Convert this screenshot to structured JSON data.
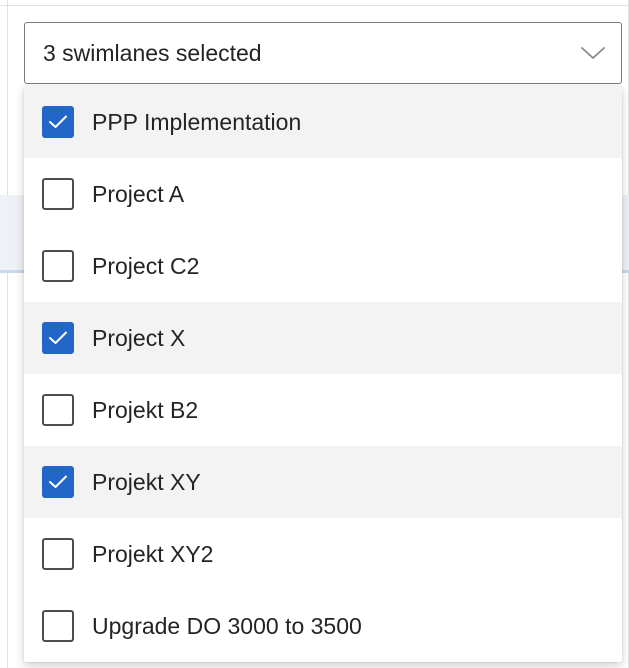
{
  "select": {
    "value": "3 swimlanes selected",
    "chevron_icon": "chevron-down-icon"
  },
  "colors": {
    "accent": "#2266c8",
    "selected_row_bg": "#f3f3f3",
    "text": "#242424"
  },
  "options": [
    {
      "label": "PPP Implementation",
      "checked": true
    },
    {
      "label": "Project A",
      "checked": false
    },
    {
      "label": "Project C2",
      "checked": false
    },
    {
      "label": "Project X",
      "checked": true
    },
    {
      "label": "Projekt B2",
      "checked": false
    },
    {
      "label": "Projekt XY",
      "checked": true
    },
    {
      "label": "Projekt XY2",
      "checked": false
    },
    {
      "label": "Upgrade DO 3000 to 3500",
      "checked": false
    }
  ]
}
